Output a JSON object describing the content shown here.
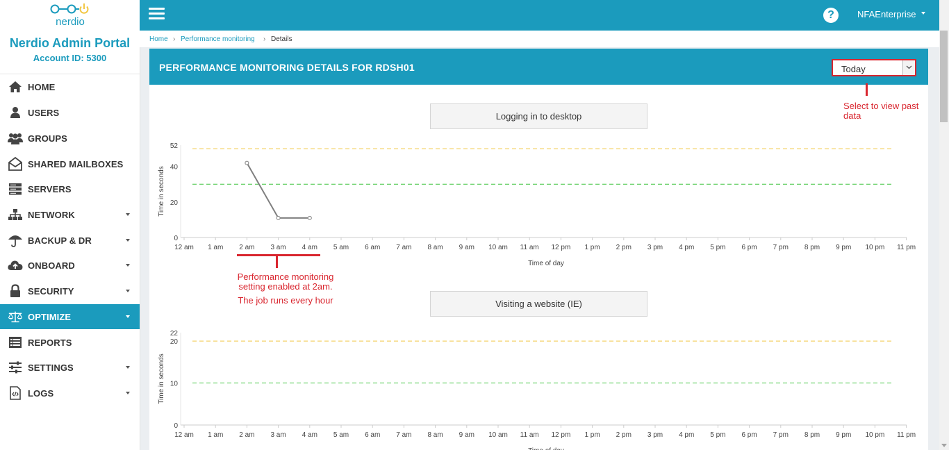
{
  "brand": {
    "logo_text": "nerdio",
    "title": "Nerdio Admin Portal",
    "account": "Account ID: 5300"
  },
  "nav": [
    {
      "label": "HOME",
      "icon": "home-icon",
      "has_caret": false,
      "active": false
    },
    {
      "label": "USERS",
      "icon": "user-icon",
      "has_caret": false,
      "active": false
    },
    {
      "label": "GROUPS",
      "icon": "group-icon",
      "has_caret": false,
      "active": false
    },
    {
      "label": "SHARED MAILBOXES",
      "icon": "mailbox-icon",
      "has_caret": false,
      "active": false
    },
    {
      "label": "SERVERS",
      "icon": "server-icon",
      "has_caret": false,
      "active": false
    },
    {
      "label": "NETWORK",
      "icon": "network-icon",
      "has_caret": true,
      "active": false
    },
    {
      "label": "BACKUP & DR",
      "icon": "umbrella-icon",
      "has_caret": true,
      "active": false
    },
    {
      "label": "ONBOARD",
      "icon": "cloud-upload-icon",
      "has_caret": true,
      "active": false
    },
    {
      "label": "SECURITY",
      "icon": "lock-icon",
      "has_caret": true,
      "active": false
    },
    {
      "label": "OPTIMIZE",
      "icon": "balance-scale-icon",
      "has_caret": true,
      "active": true
    },
    {
      "label": "REPORTS",
      "icon": "report-icon",
      "has_caret": false,
      "active": false
    },
    {
      "label": "SETTINGS",
      "icon": "sliders-icon",
      "has_caret": true,
      "active": false
    },
    {
      "label": "LOGS",
      "icon": "code-file-icon",
      "has_caret": true,
      "active": false
    }
  ],
  "header": {
    "user": "NFAEnterprise",
    "help_icon": "question-circle-icon"
  },
  "breadcrumb": {
    "home": "Home",
    "section": "Performance monitoring",
    "current": "Details",
    "sep": "›"
  },
  "panel": {
    "title": "PERFORMANCE MONITORING DETAILS FOR RDSH01",
    "period_value": "Today"
  },
  "annotations": {
    "select_hint": "Select to view past data",
    "monitoring_line1": "Performance monitoring",
    "monitoring_line2": "setting enabled at 2am.",
    "monitoring_line3": "The job runs every hour"
  },
  "colors": {
    "accent": "#1b9bbd",
    "annotation": "#d9262f",
    "warn_line": "#f2c744",
    "ok_line": "#3ec43e",
    "series": "#7f7f7f"
  },
  "chart_data": [
    {
      "type": "line",
      "title": "Logging in to desktop",
      "ylabel": "Time in seconds",
      "xlabel": "Time of day",
      "categories": [
        "12 am",
        "1 am",
        "2 am",
        "3 am",
        "4 am",
        "5 am",
        "6 am",
        "7 am",
        "8 am",
        "9 am",
        "10 am",
        "11 am",
        "12 pm",
        "1 pm",
        "2 pm",
        "3 pm",
        "4 pm",
        "5 pm",
        "6 pm",
        "7 pm",
        "8 pm",
        "9 pm",
        "10 pm",
        "11 pm"
      ],
      "yticks": [
        0,
        20,
        40,
        52
      ],
      "ylim": [
        0,
        52
      ],
      "thresholds": [
        {
          "value": 50,
          "color": "#f2c744"
        },
        {
          "value": 30,
          "color": "#3ec43e"
        }
      ],
      "series": [
        {
          "x": [
            "2 am",
            "3 am",
            "4 am"
          ],
          "values": [
            42,
            11,
            11
          ]
        }
      ]
    },
    {
      "type": "line",
      "title": "Visiting a website (IE)",
      "ylabel": "Time in seconds",
      "xlabel": "Time of day",
      "categories": [
        "12 am",
        "1 am",
        "2 am",
        "3 am",
        "4 am",
        "5 am",
        "6 am",
        "7 am",
        "8 am",
        "9 am",
        "10 am",
        "11 am",
        "12 pm",
        "1 pm",
        "2 pm",
        "3 pm",
        "4 pm",
        "5 pm",
        "6 pm",
        "7 pm",
        "8 pm",
        "9 pm",
        "10 pm",
        "11 pm"
      ],
      "yticks": [
        0,
        10,
        20,
        22
      ],
      "ylim": [
        0,
        22
      ],
      "thresholds": [
        {
          "value": 20,
          "color": "#f2c744"
        },
        {
          "value": 10,
          "color": "#3ec43e"
        }
      ],
      "series": []
    }
  ]
}
